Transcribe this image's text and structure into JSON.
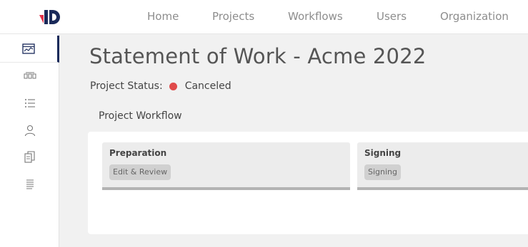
{
  "brand": {
    "logo_icon": "company-logo-icon",
    "accent": "#1a2a5a",
    "logo_red": "#e0314a"
  },
  "nav": {
    "items": [
      {
        "label": "Home"
      },
      {
        "label": "Projects"
      },
      {
        "label": "Workflows"
      },
      {
        "label": "Users"
      },
      {
        "label": "Organization"
      }
    ]
  },
  "sidebar": {
    "items": [
      {
        "icon": "dashboard-icon",
        "active": true
      },
      {
        "icon": "workflow-icon",
        "active": false
      },
      {
        "icon": "list-icon",
        "active": false
      },
      {
        "icon": "user-icon",
        "active": false
      },
      {
        "icon": "documents-icon",
        "active": false
      },
      {
        "icon": "text-lines-icon",
        "active": false
      }
    ]
  },
  "page": {
    "title": "Statement of Work - Acme 2022",
    "status_label": "Project Status:",
    "status_value": "Canceled",
    "status_color": "#e04a4a",
    "workflow_heading": "Project Workflow"
  },
  "workflow": {
    "stages": [
      {
        "name": "Preparation",
        "step": "Edit & Review"
      },
      {
        "name": "Signing",
        "step": "Signing"
      }
    ]
  }
}
